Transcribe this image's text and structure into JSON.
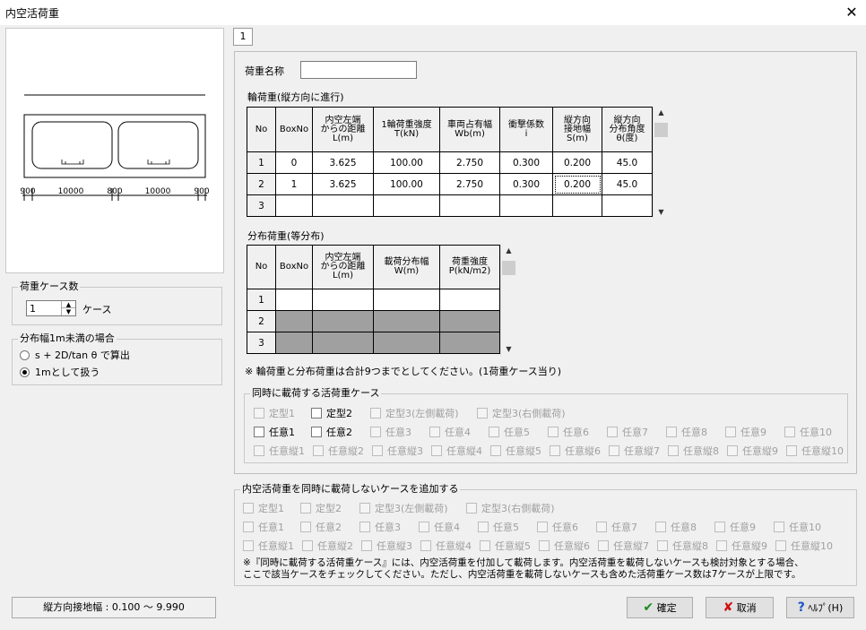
{
  "window": {
    "title": "内空活荷重"
  },
  "diagram": {
    "dims": [
      "900",
      "10000",
      "800",
      "10000",
      "900"
    ]
  },
  "load_case_count": {
    "label": "荷重ケース数",
    "value": "1",
    "unit": "ケース"
  },
  "distribution_width": {
    "label": "分布幅1m未満の場合",
    "option1": "s + 2D/tan θ で算出",
    "option2": "1mとして扱う",
    "selected": 2
  },
  "status": {
    "text": "縦方向接地幅 : 0.100 ～ 9.990"
  },
  "tab": {
    "label": "1"
  },
  "load_name": {
    "label": "荷重名称",
    "value": ""
  },
  "wheel_load": {
    "title": "輪荷重(縦方向に進行)",
    "headers": [
      "No",
      "BoxNo",
      "内空左端\nからの距離\nL(m)",
      "1輪荷重強度\nT(kN)",
      "車両占有幅\nWb(m)",
      "衝撃係数\ni",
      "縦方向\n接地幅\nS(m)",
      "縦方向\n分布角度\nθ(度)"
    ],
    "rows": [
      [
        "1",
        "0",
        "3.625",
        "100.00",
        "2.750",
        "0.300",
        "0.200",
        "45.0"
      ],
      [
        "2",
        "1",
        "3.625",
        "100.00",
        "2.750",
        "0.300",
        "0.200",
        "45.0"
      ],
      [
        "3",
        "",
        "",
        "",
        "",
        "",
        "",
        ""
      ]
    ]
  },
  "dist_load": {
    "title": "分布荷重(等分布)",
    "headers": [
      "No",
      "BoxNo",
      "内空左端\nからの距離\nL(m)",
      "載荷分布幅\nW(m)",
      "荷重強度\nP(kN/m2)"
    ],
    "rows": [
      [
        "1",
        "",
        "",
        "",
        ""
      ],
      [
        "2",
        "",
        "",
        "",
        ""
      ],
      [
        "3",
        "",
        "",
        "",
        ""
      ]
    ]
  },
  "note1": "※ 輪荷重と分布荷重は合計9つまでとしてください。(1荷重ケース当り)",
  "simultaneous": {
    "title": "同時に載荷する活荷重ケース",
    "row1": [
      "定型1",
      "定型2",
      "定型3(左側載荷)",
      "定型3(右側載荷)"
    ],
    "row2": [
      "任意1",
      "任意2",
      "任意3",
      "任意4",
      "任意5",
      "任意6",
      "任意7",
      "任意8",
      "任意9",
      "任意10"
    ],
    "row3": [
      "任意縦1",
      "任意縦2",
      "任意縦3",
      "任意縦4",
      "任意縦5",
      "任意縦6",
      "任意縦7",
      "任意縦8",
      "任意縦9",
      "任意縦10"
    ]
  },
  "non_loading": {
    "title": "内空活荷重を同時に載荷しないケースを追加する",
    "row1": [
      "定型1",
      "定型2",
      "定型3(左側載荷)",
      "定型3(右側載荷)"
    ],
    "row2": [
      "任意1",
      "任意2",
      "任意3",
      "任意4",
      "任意5",
      "任意6",
      "任意7",
      "任意8",
      "任意9",
      "任意10"
    ],
    "row3": [
      "任意縦1",
      "任意縦2",
      "任意縦3",
      "任意縦4",
      "任意縦5",
      "任意縦6",
      "任意縦7",
      "任意縦8",
      "任意縦9",
      "任意縦10"
    ],
    "note_line1": "※『同時に載荷する活荷重ケース』には、内空活荷重を付加して載荷します。内空活荷重を載荷しないケースも検討対象とする場合、",
    "note_line2": "ここで該当ケースをチェックしてください。ただし、内空活荷重を載荷しないケースも含めた活荷重ケース数は7ケースが上限です。"
  },
  "buttons": {
    "ok": "確定",
    "cancel": "取消",
    "help": "ﾍﾙﾌﾟ(H)"
  },
  "colors": {
    "ok_icon": "#1a8a1a",
    "cancel_icon": "#d01010",
    "help_icon": "#1f55c6",
    "disabled_cell": "#a0a0a0"
  }
}
